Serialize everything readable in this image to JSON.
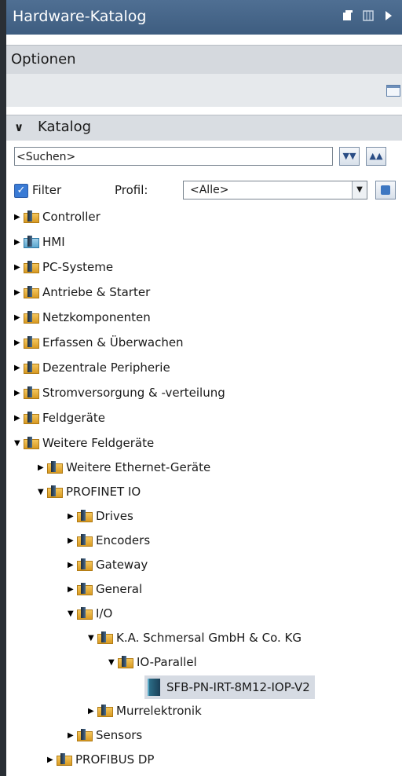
{
  "window": {
    "title": "Hardware-Katalog"
  },
  "optionen": {
    "label": "Optionen"
  },
  "katalog": {
    "label": "Katalog",
    "search_value": "<Suchen>",
    "filter_label": "Filter",
    "filter_checked": true,
    "profil_label": "Profil:",
    "profil_value": "<Alle>"
  },
  "tree": {
    "controller": "Controller",
    "hmi": "HMI",
    "pc_systeme": "PC-Systeme",
    "antriebe": "Antriebe & Starter",
    "netzkomponenten": "Netzkomponenten",
    "erfassen": "Erfassen & Überwachen",
    "dezentrale": "Dezentrale Peripherie",
    "stromversorgung": "Stromversorgung & -verteilung",
    "feldgeraete": "Feldgeräte",
    "weitere_feldgeraete": "Weitere Feldgeräte",
    "weitere_ethernet": "Weitere Ethernet-Geräte",
    "profinet_io": "PROFINET IO",
    "drives": "Drives",
    "encoders": "Encoders",
    "gateway": "Gateway",
    "general": "General",
    "io": "I/O",
    "schmersal": "K.A. Schmersal GmbH & Co. KG",
    "io_parallel": "IO-Parallel",
    "device": "SFB-PN-IRT-8M12-IOP-V2",
    "murrelektronik": "Murrelektronik",
    "sensors": "Sensors",
    "profibus_dp": "PROFIBUS DP"
  }
}
